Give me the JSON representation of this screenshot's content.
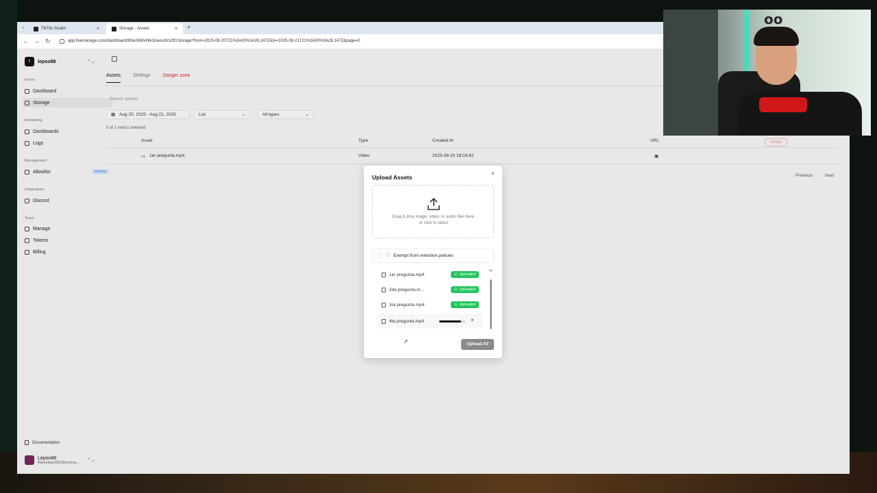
{
  "browser": {
    "tabs": [
      {
        "title": "TikTok Studio",
        "close": "×"
      },
      {
        "title": "Storage - Assets",
        "close": "×"
      }
    ],
    "new_tab": "+",
    "tab_menu": "⌄",
    "url": "app.fivemanage.com/dashboard/90w26WvWkJlceesdVs2fC/storage?from=2025-08-20T21%3A00%3A26.147Z&to=2025-08-21T21%3A00%3A26.147Z&page=0",
    "nav": {
      "back": "←",
      "forward": "→",
      "reload": "↻"
    }
  },
  "sidebar": {
    "org_name": "lepoo88",
    "org_initial": "l",
    "chevron": "⌃⌄",
    "sections": [
      {
        "label": "Home",
        "items": [
          {
            "label": "Dashboard"
          },
          {
            "label": "Storage"
          }
        ]
      },
      {
        "label": "Monitoring",
        "items": [
          {
            "label": "Dashboards"
          },
          {
            "label": "Logs"
          }
        ]
      },
      {
        "label": "Management",
        "items": [
          {
            "label": "Allowlist",
            "badge": "Waitlist"
          }
        ]
      },
      {
        "label": "Integrations",
        "items": [
          {
            "label": "Discord"
          }
        ]
      },
      {
        "label": "Team",
        "items": [
          {
            "label": "Manage"
          },
          {
            "label": "Tokens"
          },
          {
            "label": "Billing"
          }
        ]
      }
    ],
    "documentation": "Documentation",
    "user": {
      "name": "Lepoo88",
      "email": "fllamellas2002@hotma..."
    }
  },
  "main": {
    "tabs": [
      {
        "label": "Assets"
      },
      {
        "label": "Settings"
      },
      {
        "label": "Danger zone"
      }
    ],
    "search_placeholder": "Search assets",
    "date_range": "Aug 20, 2025 - Aug 21, 2025",
    "view": "List",
    "type_filter": "All types",
    "selection": "0 of 1 row(s) selected.",
    "table": {
      "headers": [
        "Asset",
        "Type",
        "Created At",
        "URL"
      ],
      "rows": [
        [
          "1er pregunta.mp4",
          "Video",
          "2025-08-20 18:03:42",
          ""
        ]
      ]
    },
    "delete_label": "Delete",
    "prev": "Previous",
    "next": "Next"
  },
  "modal": {
    "title": "Upload Assets",
    "close": "×",
    "drop_line1": "Drag & drop image, video, or audio files here,",
    "drop_line2": "or click to select",
    "exempt_label": "Exempt from retention policies",
    "files": [
      {
        "name": "1er pregunta.mp4",
        "status": "Uploaded"
      },
      {
        "name": "2da pregunta.m...",
        "status": "Uploaded"
      },
      {
        "name": "3ra pregunta.mp4",
        "status": "Uploaded"
      },
      {
        "name": "4ta pregunta.mp4",
        "status": "",
        "progress": 0.85,
        "cancel": "×"
      }
    ],
    "upload_all": "Upload All",
    "scroll_up": "▲",
    "scroll_down": "▼"
  },
  "colors": {
    "success": "#22c55e",
    "danger": "#dc2626",
    "badge": "#3b82f6"
  }
}
